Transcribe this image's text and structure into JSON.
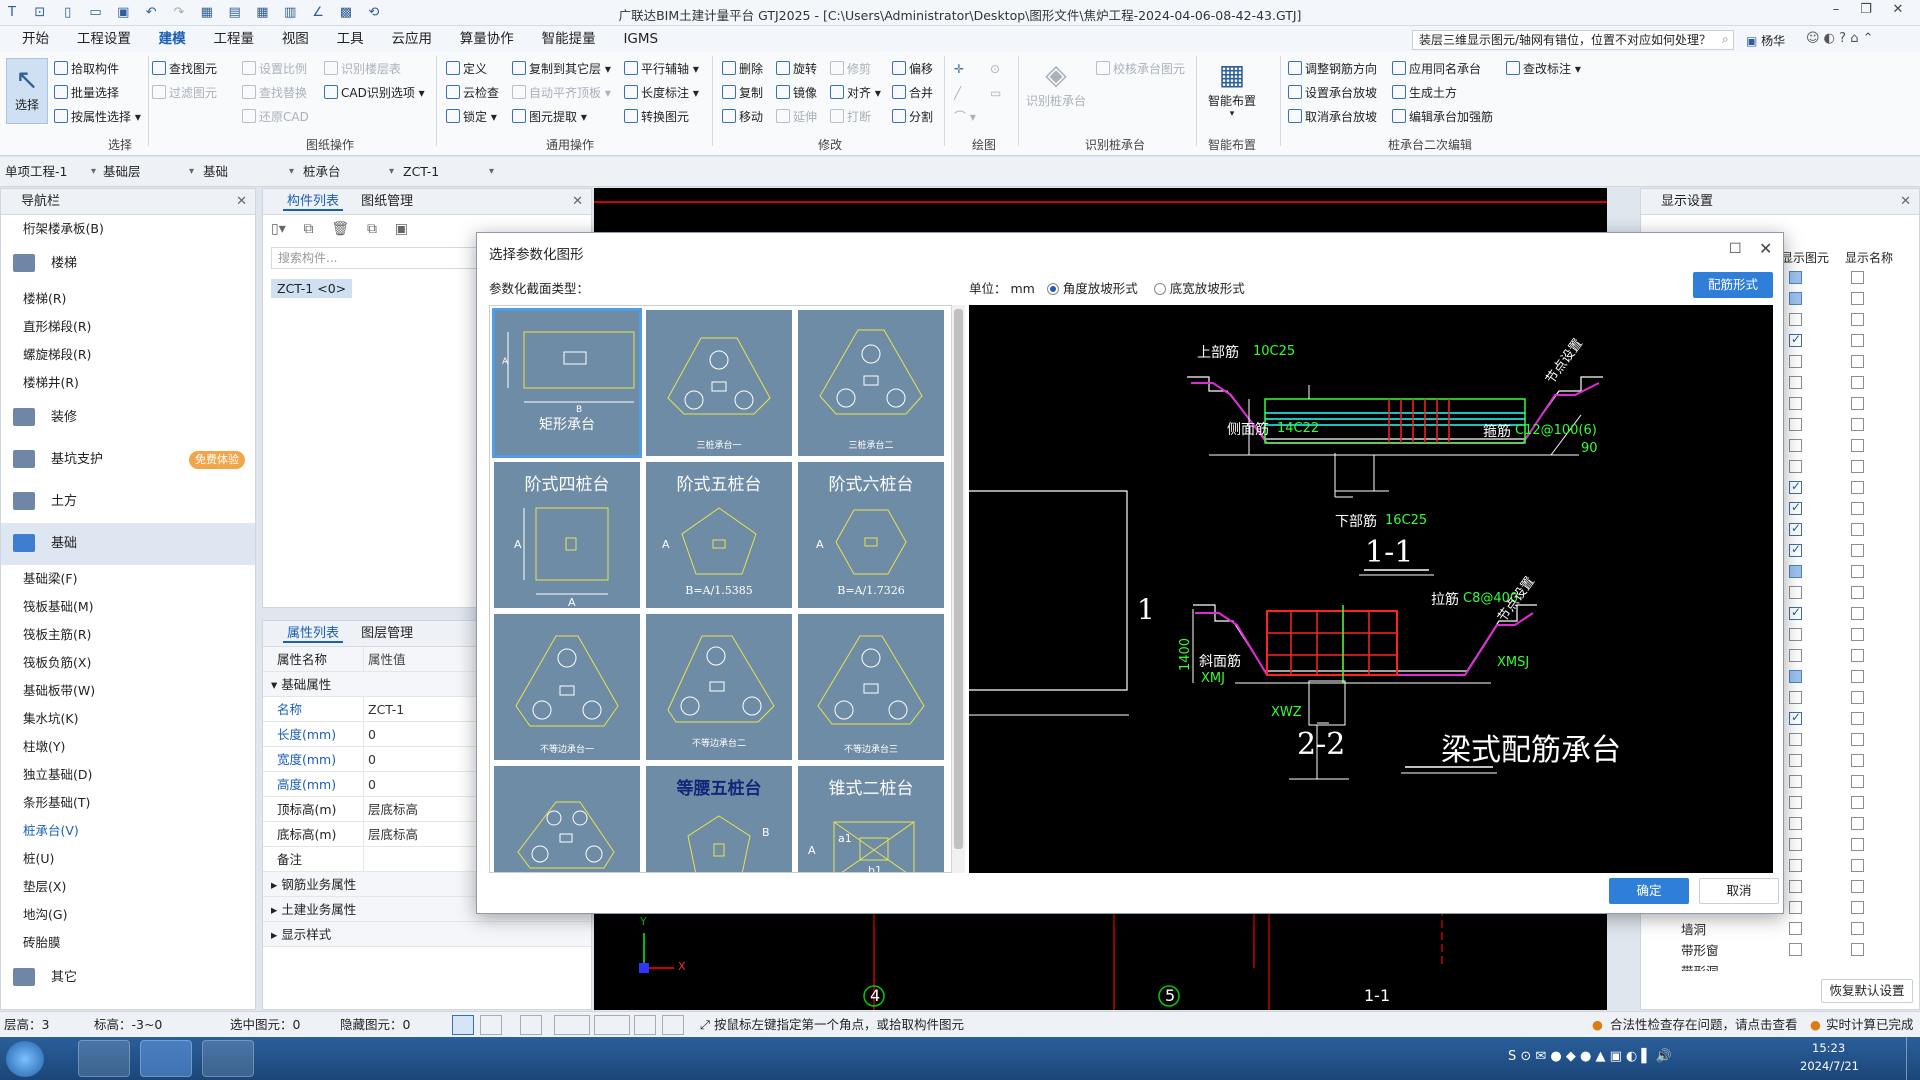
{
  "app": {
    "title": "广联达BIM土建计量平台 GTJ2025 - [C:\\Users\\Administrator\\Desktop\\图形文件\\焦炉工程-2024-04-06-08-42-43.GTJ]",
    "minimize": "–",
    "restore": "❐",
    "close": "✕"
  },
  "menu": {
    "items": [
      "开始",
      "工程设置",
      "建模",
      "工程量",
      "视图",
      "工具",
      "云应用",
      "算量协作",
      "智能提量",
      "IGMS"
    ],
    "active": "建模",
    "help_search": "装层三维显示图元/轴网有错位，位置不对应如何处理？",
    "user": "杨华"
  },
  "ribbon": {
    "select_group": {
      "big": "选择",
      "items": [
        "拾取构件",
        "批量选择",
        "按属性选择"
      ],
      "label": "选择"
    },
    "drawing_ops": {
      "items": [
        "查找图元",
        "过滤图元",
        "设置比例",
        "查找替换",
        "还原CAD",
        "识别楼层表",
        "CAD识别选项"
      ],
      "label": "图纸操作"
    },
    "common_ops": {
      "items": [
        "定义",
        "云检查",
        "锁定",
        "复制到其它层",
        "自动平齐顶板",
        "图元提取",
        "平行辅轴",
        "长度标注",
        "转换图元"
      ],
      "label": "通用操作"
    },
    "modify": {
      "items": [
        "删除",
        "旋转",
        "修剪",
        "偏移",
        "复制",
        "镜像",
        "对齐",
        "合并",
        "移动",
        "延伸",
        "打断",
        "分割"
      ],
      "label": "修改"
    },
    "draw_label": "绘图",
    "identify": {
      "big": "识别桩承台",
      "item": "校核承台图元",
      "label": "识别桩承台"
    },
    "smart": {
      "big": "智能布置",
      "label": "智能布置"
    },
    "secondary": {
      "items": [
        "调整钢筋方向",
        "应用同名承台",
        "查改标注",
        "设置承台放坡",
        "生成土方",
        "取消承台放坡",
        "编辑承台加强筋"
      ],
      "label": "桩承台二次编辑"
    }
  },
  "selectors": [
    "单项工程-1",
    "基础层",
    "基础",
    "桩承台",
    "ZCT-1"
  ],
  "nav": {
    "title": "导航栏",
    "top_item": "桁架楼承板(B)",
    "categories": [
      {
        "name": "楼梯",
        "items": [
          "楼梯(R)",
          "直形梯段(R)",
          "螺旋梯段(R)",
          "楼梯井(R)"
        ]
      },
      {
        "name": "装修",
        "items": []
      },
      {
        "name": "基坑支护",
        "items": [],
        "badge": "免费体验"
      },
      {
        "name": "土方",
        "items": []
      },
      {
        "name": "基础",
        "items": [
          "基础梁(F)",
          "筏板基础(M)",
          "筏板主筋(R)",
          "筏板负筋(X)",
          "基础板带(W)",
          "集水坑(K)",
          "柱墩(Y)",
          "独立基础(D)",
          "条形基础(T)",
          "桩承台(V)",
          "桩(U)",
          "垫层(X)",
          "地沟(G)",
          "砖胎膜"
        ]
      },
      {
        "name": "其它",
        "items": []
      }
    ],
    "selected_item": "桩承台(V)"
  },
  "component_list": {
    "tabs": [
      "构件列表",
      "图纸管理"
    ],
    "search_placeholder": "搜索构件...",
    "item": "ZCT-1 <0>"
  },
  "properties": {
    "tabs": [
      "属性列表",
      "图层管理"
    ],
    "headers": [
      "属性名称",
      "属性值"
    ],
    "section": "基础属性",
    "rows": [
      {
        "k": "名称",
        "v": "ZCT-1"
      },
      {
        "k": "长度(mm)",
        "v": "0"
      },
      {
        "k": "宽度(mm)",
        "v": "0"
      },
      {
        "k": "高度(mm)",
        "v": "0"
      },
      {
        "k": "顶标高(m)",
        "v": "层底标高"
      },
      {
        "k": "底标高(m)",
        "v": "层底标高"
      },
      {
        "k": "备注",
        "v": ""
      }
    ],
    "groups": [
      "钢筋业务属性",
      "土建业务属性",
      "显示样式"
    ]
  },
  "dialog": {
    "title": "选择参数化图形",
    "type_label": "参数化截面类型：",
    "unit_label": "单位：",
    "unit": "mm",
    "radio1": "角度放坡形式",
    "radio2": "底宽放坡形式",
    "rebar_btn": "配筋形式",
    "ok": "确定",
    "cancel": "取消",
    "thumbs": [
      {
        "label": "矩形承台",
        "sub": ""
      },
      {
        "label": "",
        "sub": "三桩承台一"
      },
      {
        "label": "",
        "sub": "三桩承台二"
      },
      {
        "label": "阶式四桩台",
        "sub": ""
      },
      {
        "label": "阶式五桩台",
        "sub": "B=A/1.5385"
      },
      {
        "label": "阶式六桩台",
        "sub": "B=A/1.7326"
      },
      {
        "label": "",
        "sub": "不等边承台一"
      },
      {
        "label": "",
        "sub": "不等边承台二"
      },
      {
        "label": "",
        "sub": "不等边承台三"
      },
      {
        "label": "",
        "sub": ""
      },
      {
        "label": "等腰五桩台",
        "sub": ""
      },
      {
        "label": "锥式二桩台",
        "sub": ""
      }
    ],
    "preview": {
      "top_bar": "上部筋",
      "top_bar_v": "10C25",
      "side_bar": "侧面筋",
      "side_bar_v": "14C22",
      "stirrup": "箍筋",
      "stirrup_v": "C12@100(6)",
      "bottom_bar": "下部筋",
      "bottom_bar_v": "16C25",
      "node": "节点设置",
      "angle": "90",
      "sec1": "1-1",
      "tie": "拉筋",
      "tie_v": "C8@400",
      "slant": "斜面筋",
      "xmj": "XMJ",
      "xmsj": "XMSJ",
      "xwz": "XWZ",
      "h1400": "1400",
      "sec2": "2-2",
      "caption": "梁式配筋承台",
      "one": "1"
    }
  },
  "display": {
    "title": "显示设置",
    "cols": [
      "显示图元",
      "显示名称"
    ],
    "visible_rows": [
      "墙洞",
      "带形窗",
      "带形洞"
    ],
    "reset": "恢复默认设置"
  },
  "status": {
    "floor": "层高：3",
    "elev": "标高：-3~0",
    "selected": "选中图元：0",
    "hidden": "隐藏图元：0",
    "hint": "按鼠标左键指定第一个角点，或拾取构件图元",
    "check": "合法性检查存在问题，请点击查看",
    "calc": "实时计算已完成"
  },
  "axis": {
    "x": "X",
    "y": "Y"
  },
  "grid_labels": [
    "4",
    "5",
    "1-1"
  ],
  "taskbar": {
    "time": "15:23",
    "date": "2024/7/21"
  }
}
